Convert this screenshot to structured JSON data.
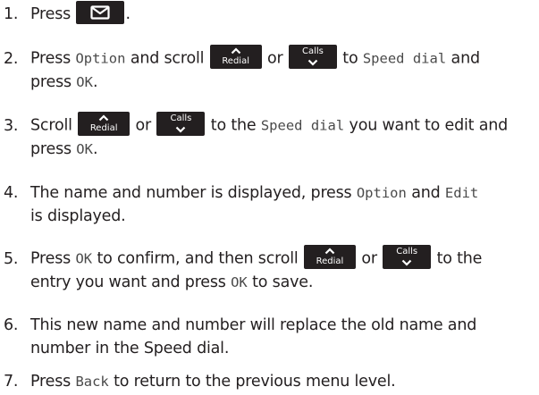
{
  "keys": {
    "envelope": "envelope-icon",
    "redial_label": "Redial",
    "calls_label": "Calls"
  },
  "steps": {
    "s1": {
      "num": "1.",
      "t1": "Press",
      "t2": "."
    },
    "s2": {
      "num": "2.",
      "t1": "Press",
      "lcd1": "Option",
      "t2": "and scroll",
      "t3": "or",
      "t4": "to",
      "lcd2": "Speed dial",
      "t5": "and",
      "t6": "press",
      "lcd3": "OK",
      "t7": "."
    },
    "s3": {
      "num": "3.",
      "t1": "Scroll",
      "t2": "or",
      "t3": "to the",
      "lcd1": "Speed dial",
      "t4": "you want to edit and",
      "t5": "press",
      "lcd2": "OK",
      "t6": "."
    },
    "s4": {
      "num": "4.",
      "t1": "The name and number is displayed, press",
      "lcd1": "Option",
      "t2": "and",
      "lcd2": "Edit",
      "t3": "is displayed."
    },
    "s5": {
      "num": "5.",
      "t1": "Press",
      "lcd1": "OK",
      "t2": "to confirm, and then scroll",
      "t3": "or",
      "t4": "to the",
      "t5": "entry you want and press",
      "lcd2": "OK",
      "t6": "to save."
    },
    "s6": {
      "num": "6.",
      "t1": "This new name and number will replace the old name and",
      "t2": "number in the Speed dial."
    },
    "s7": {
      "num": "7.",
      "t1": "Press",
      "lcd1": "Back",
      "t2": "to return to the previous menu level."
    }
  }
}
